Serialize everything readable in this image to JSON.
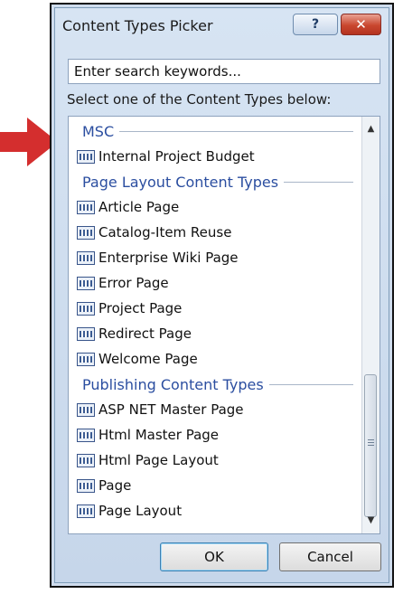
{
  "dialog": {
    "title": "Content Types Picker",
    "help_label": "?",
    "close_label": "✕"
  },
  "search": {
    "placeholder": "Enter search keywords..."
  },
  "instruction": "Select one of the Content Types below:",
  "groups": [
    {
      "name": "MSC",
      "items": [
        "Internal Project Budget"
      ]
    },
    {
      "name": "Page Layout Content Types",
      "items": [
        "Article Page",
        "Catalog-Item Reuse",
        "Enterprise Wiki Page",
        "Error Page",
        "Project Page",
        "Redirect Page",
        "Welcome Page"
      ]
    },
    {
      "name": "Publishing Content Types",
      "items": [
        "ASP NET Master Page",
        "Html Master Page",
        "Html Page Layout",
        "Page",
        "Page Layout"
      ]
    }
  ],
  "scrollbar": {
    "up_arrow": "▲",
    "down_arrow": "▼"
  },
  "buttons": {
    "ok": "OK",
    "cancel": "Cancel"
  },
  "colors": {
    "arrow": "#d42e2e",
    "group_header": "#2b4ea0",
    "close_button": "#c9472f"
  }
}
